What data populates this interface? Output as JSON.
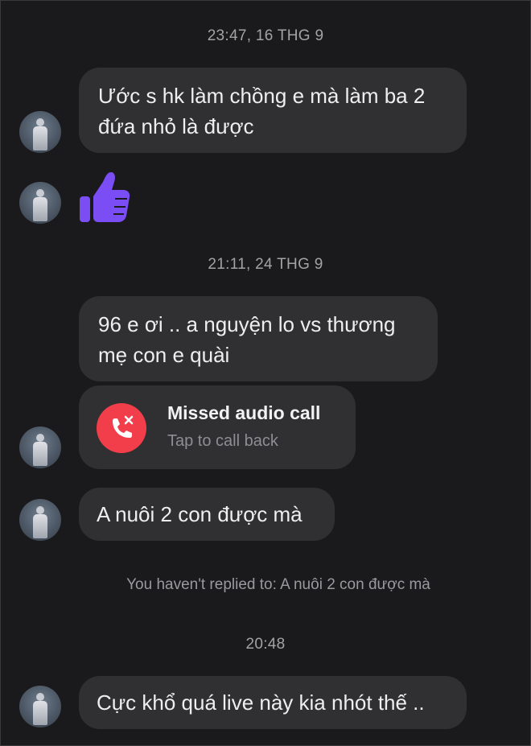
{
  "chat": {
    "timestamps": [
      "23:47, 16 THG 9",
      "21:11, 24 THG 9",
      "20:48"
    ],
    "messages": [
      {
        "text": "Ước s hk làm chồng e mà làm ba 2\nđứa nhỏ là được"
      },
      {
        "text": "96 e ơi .. a nguyện lo vs thương\nmẹ con e quài"
      },
      {
        "text": "A nuôi 2 con được mà"
      },
      {
        "text": "Cực khổ quá live này kia nhót thế .."
      }
    ],
    "reaction_icon": "thumbs-up-icon",
    "missed_call": {
      "title": "Missed audio call",
      "subtitle": "Tap to call back",
      "icon": "missed-call-icon"
    },
    "reply_note": "You haven't replied to: A nuôi 2 con được mà"
  },
  "colors": {
    "background": "#1a1a1c",
    "bubble": "#303033",
    "text": "#eeeeef",
    "timestamp": "#a3a3a6",
    "like_purple": "#7a4df5",
    "missed_call_red": "#f23d4b"
  }
}
